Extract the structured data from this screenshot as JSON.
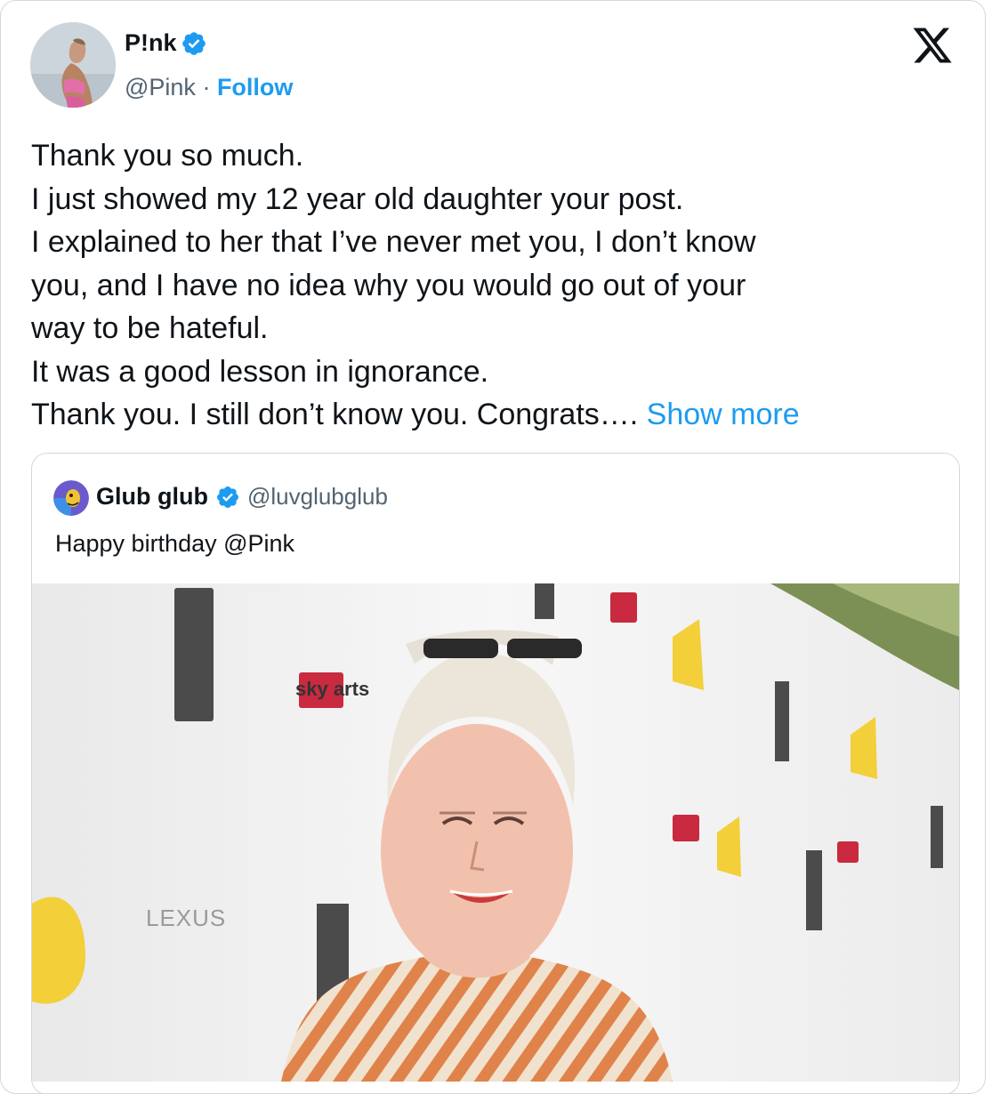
{
  "tweet": {
    "author": {
      "name": "P!nk",
      "handle": "@Pink",
      "separator": " · ",
      "follow_label": "Follow"
    },
    "text_lines": [
      "Thank you so much.",
      "I just showed my 12 year old daughter your post.",
      "I explained to her that I’ve never met you, I don’t know",
      "you, and I have no idea why you would go out of your",
      "way to be hateful.",
      "It was a good lesson in ignorance.",
      "Thank you. I still don’t know you. Congrats…."
    ],
    "show_more_label": "Show more"
  },
  "quote": {
    "name": "Glub glub",
    "handle": "@luvglubglub",
    "text": "Happy birthday @Pink"
  },
  "photo_backdrop_text": {
    "sponsor": "LEXUS",
    "broadcaster": "sky arts"
  },
  "colors": {
    "accent": "#1d9bf0",
    "text": "#0f1419",
    "muted": "#536471",
    "border": "#cfd9de"
  },
  "icons": {
    "verified": "verified-badge-icon",
    "platform": "x-logo-icon"
  }
}
